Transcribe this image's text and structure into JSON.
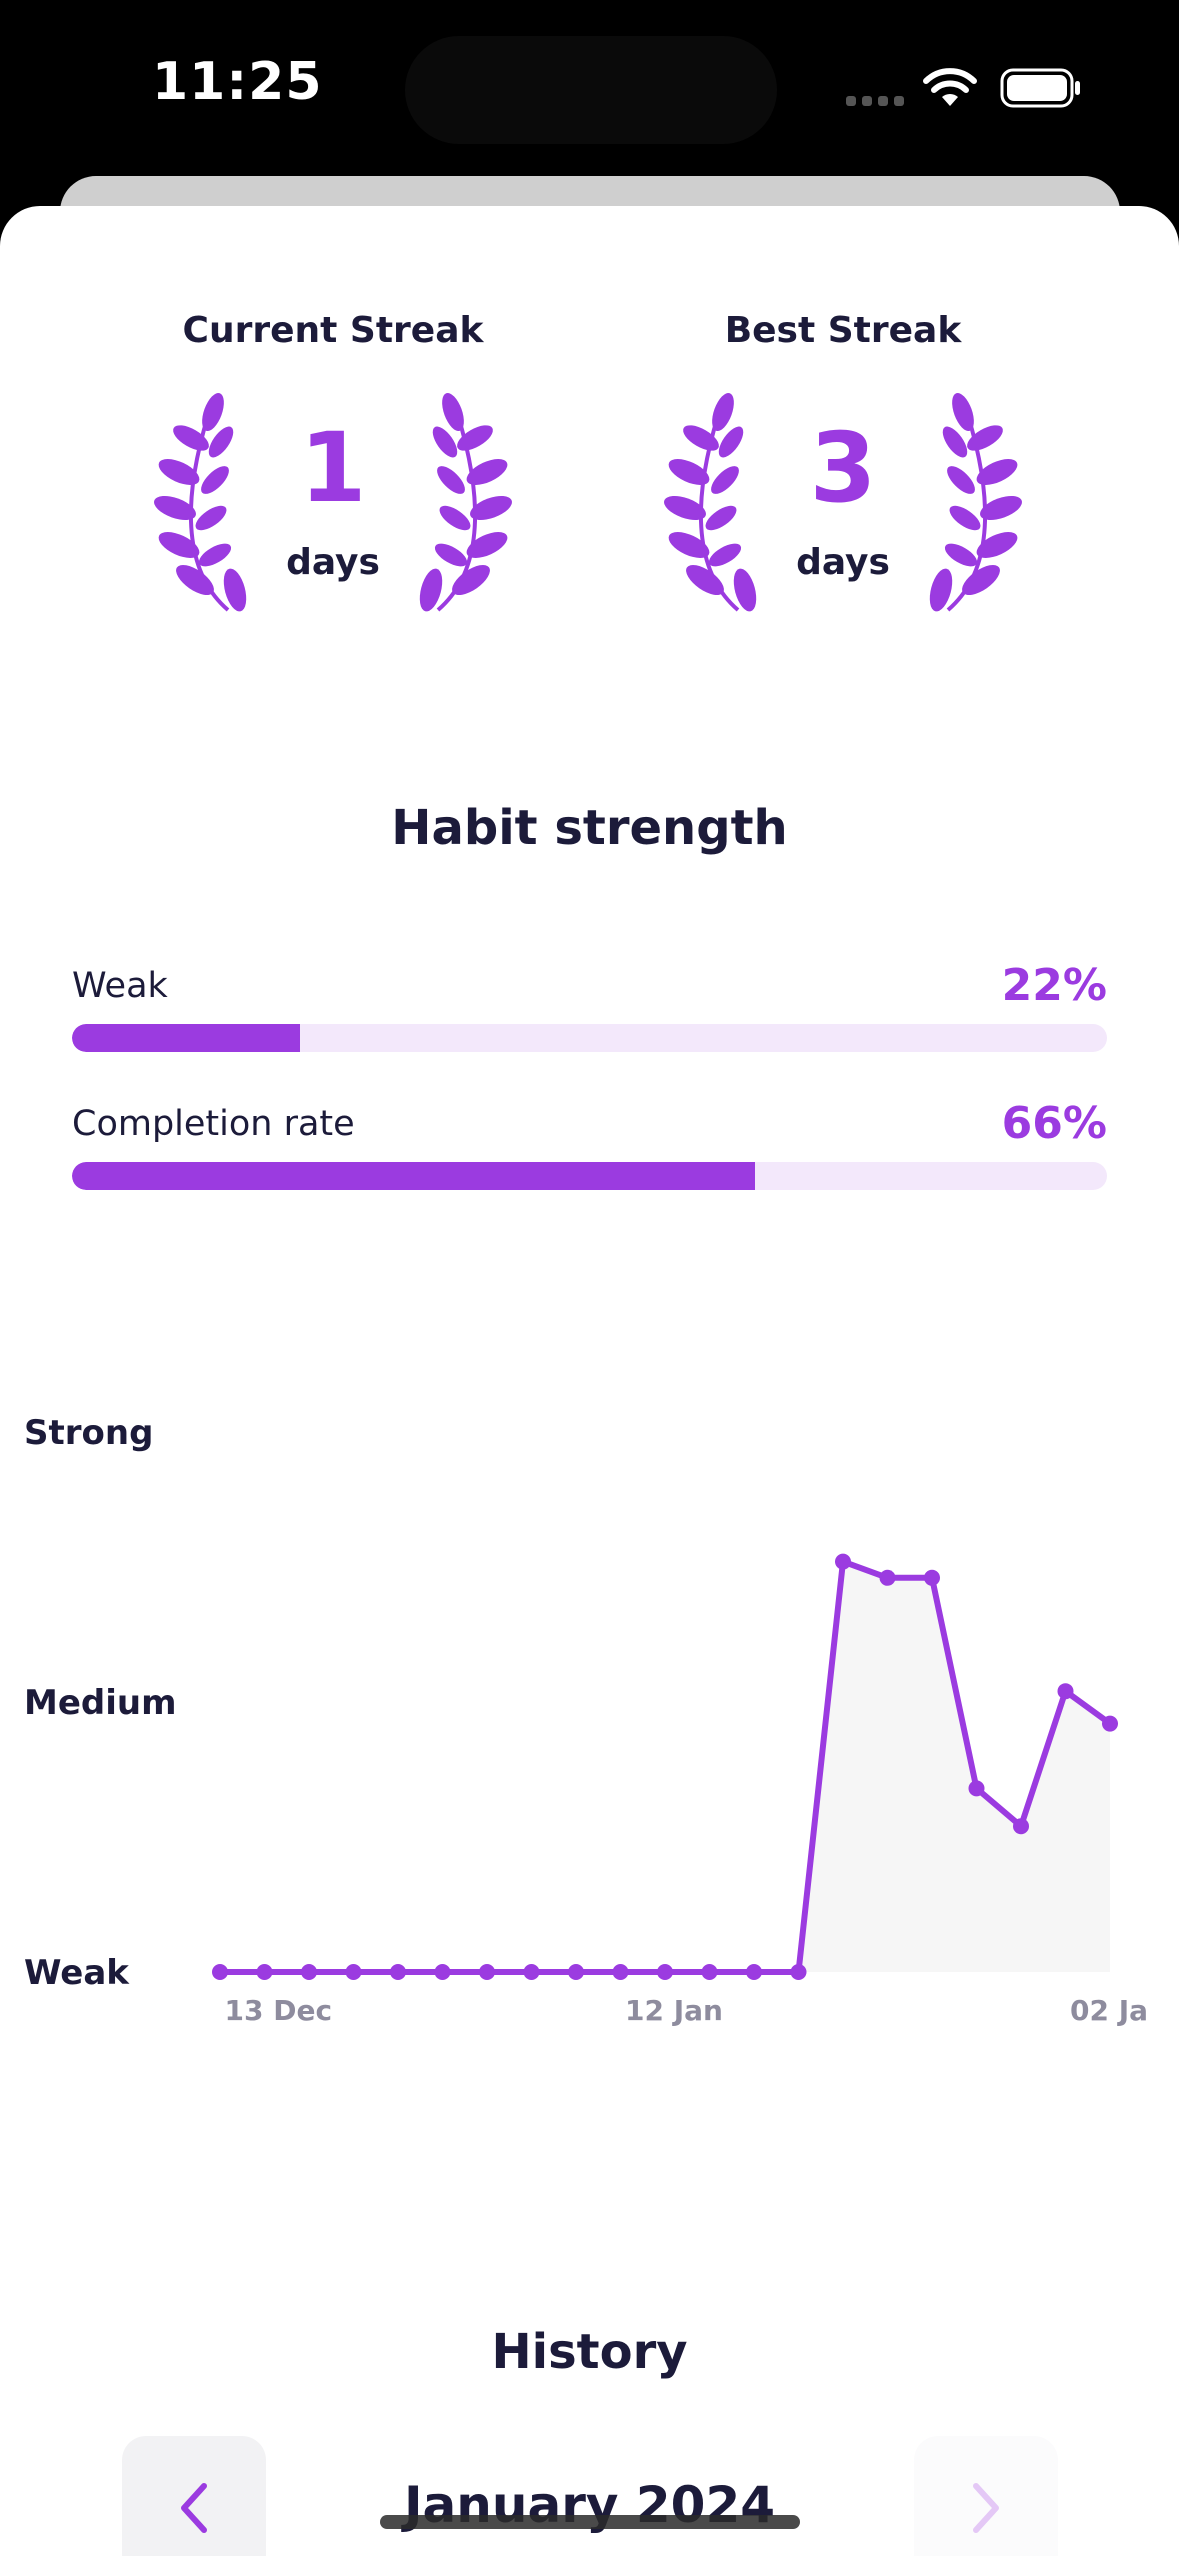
{
  "status_bar": {
    "time": "11:25"
  },
  "streaks": {
    "current": {
      "title": "Current Streak",
      "value": "1",
      "unit": "days"
    },
    "best": {
      "title": "Best Streak",
      "value": "3",
      "unit": "days"
    }
  },
  "habit_strength": {
    "title": "Habit strength",
    "strength": {
      "label": "Weak",
      "value_text": "22%",
      "fraction": 0.22
    },
    "completion": {
      "label": "Completion rate",
      "value_text": "66%",
      "fraction": 0.66
    }
  },
  "chart_data": {
    "type": "area",
    "y_levels": [
      "Weak",
      "Medium",
      "Strong"
    ],
    "x_tick_labels": [
      "13 Dec",
      "12 Jan",
      "02 Ja"
    ],
    "ylim": [
      0,
      1
    ],
    "series": [
      {
        "values": [
          0,
          0,
          0,
          0,
          0,
          0,
          0,
          0,
          0,
          0,
          0,
          0,
          0,
          0,
          0.76,
          0.73,
          0.73,
          0.34,
          0.27,
          0.52,
          0.46
        ]
      }
    ],
    "color": "#9b3be0",
    "fill_color": "#f6f6f6"
  },
  "history": {
    "title": "History",
    "month": "January 2024"
  },
  "colors": {
    "accent": "#9b3be0",
    "text": "#1c1b3a",
    "track": "#f3e8fb"
  }
}
